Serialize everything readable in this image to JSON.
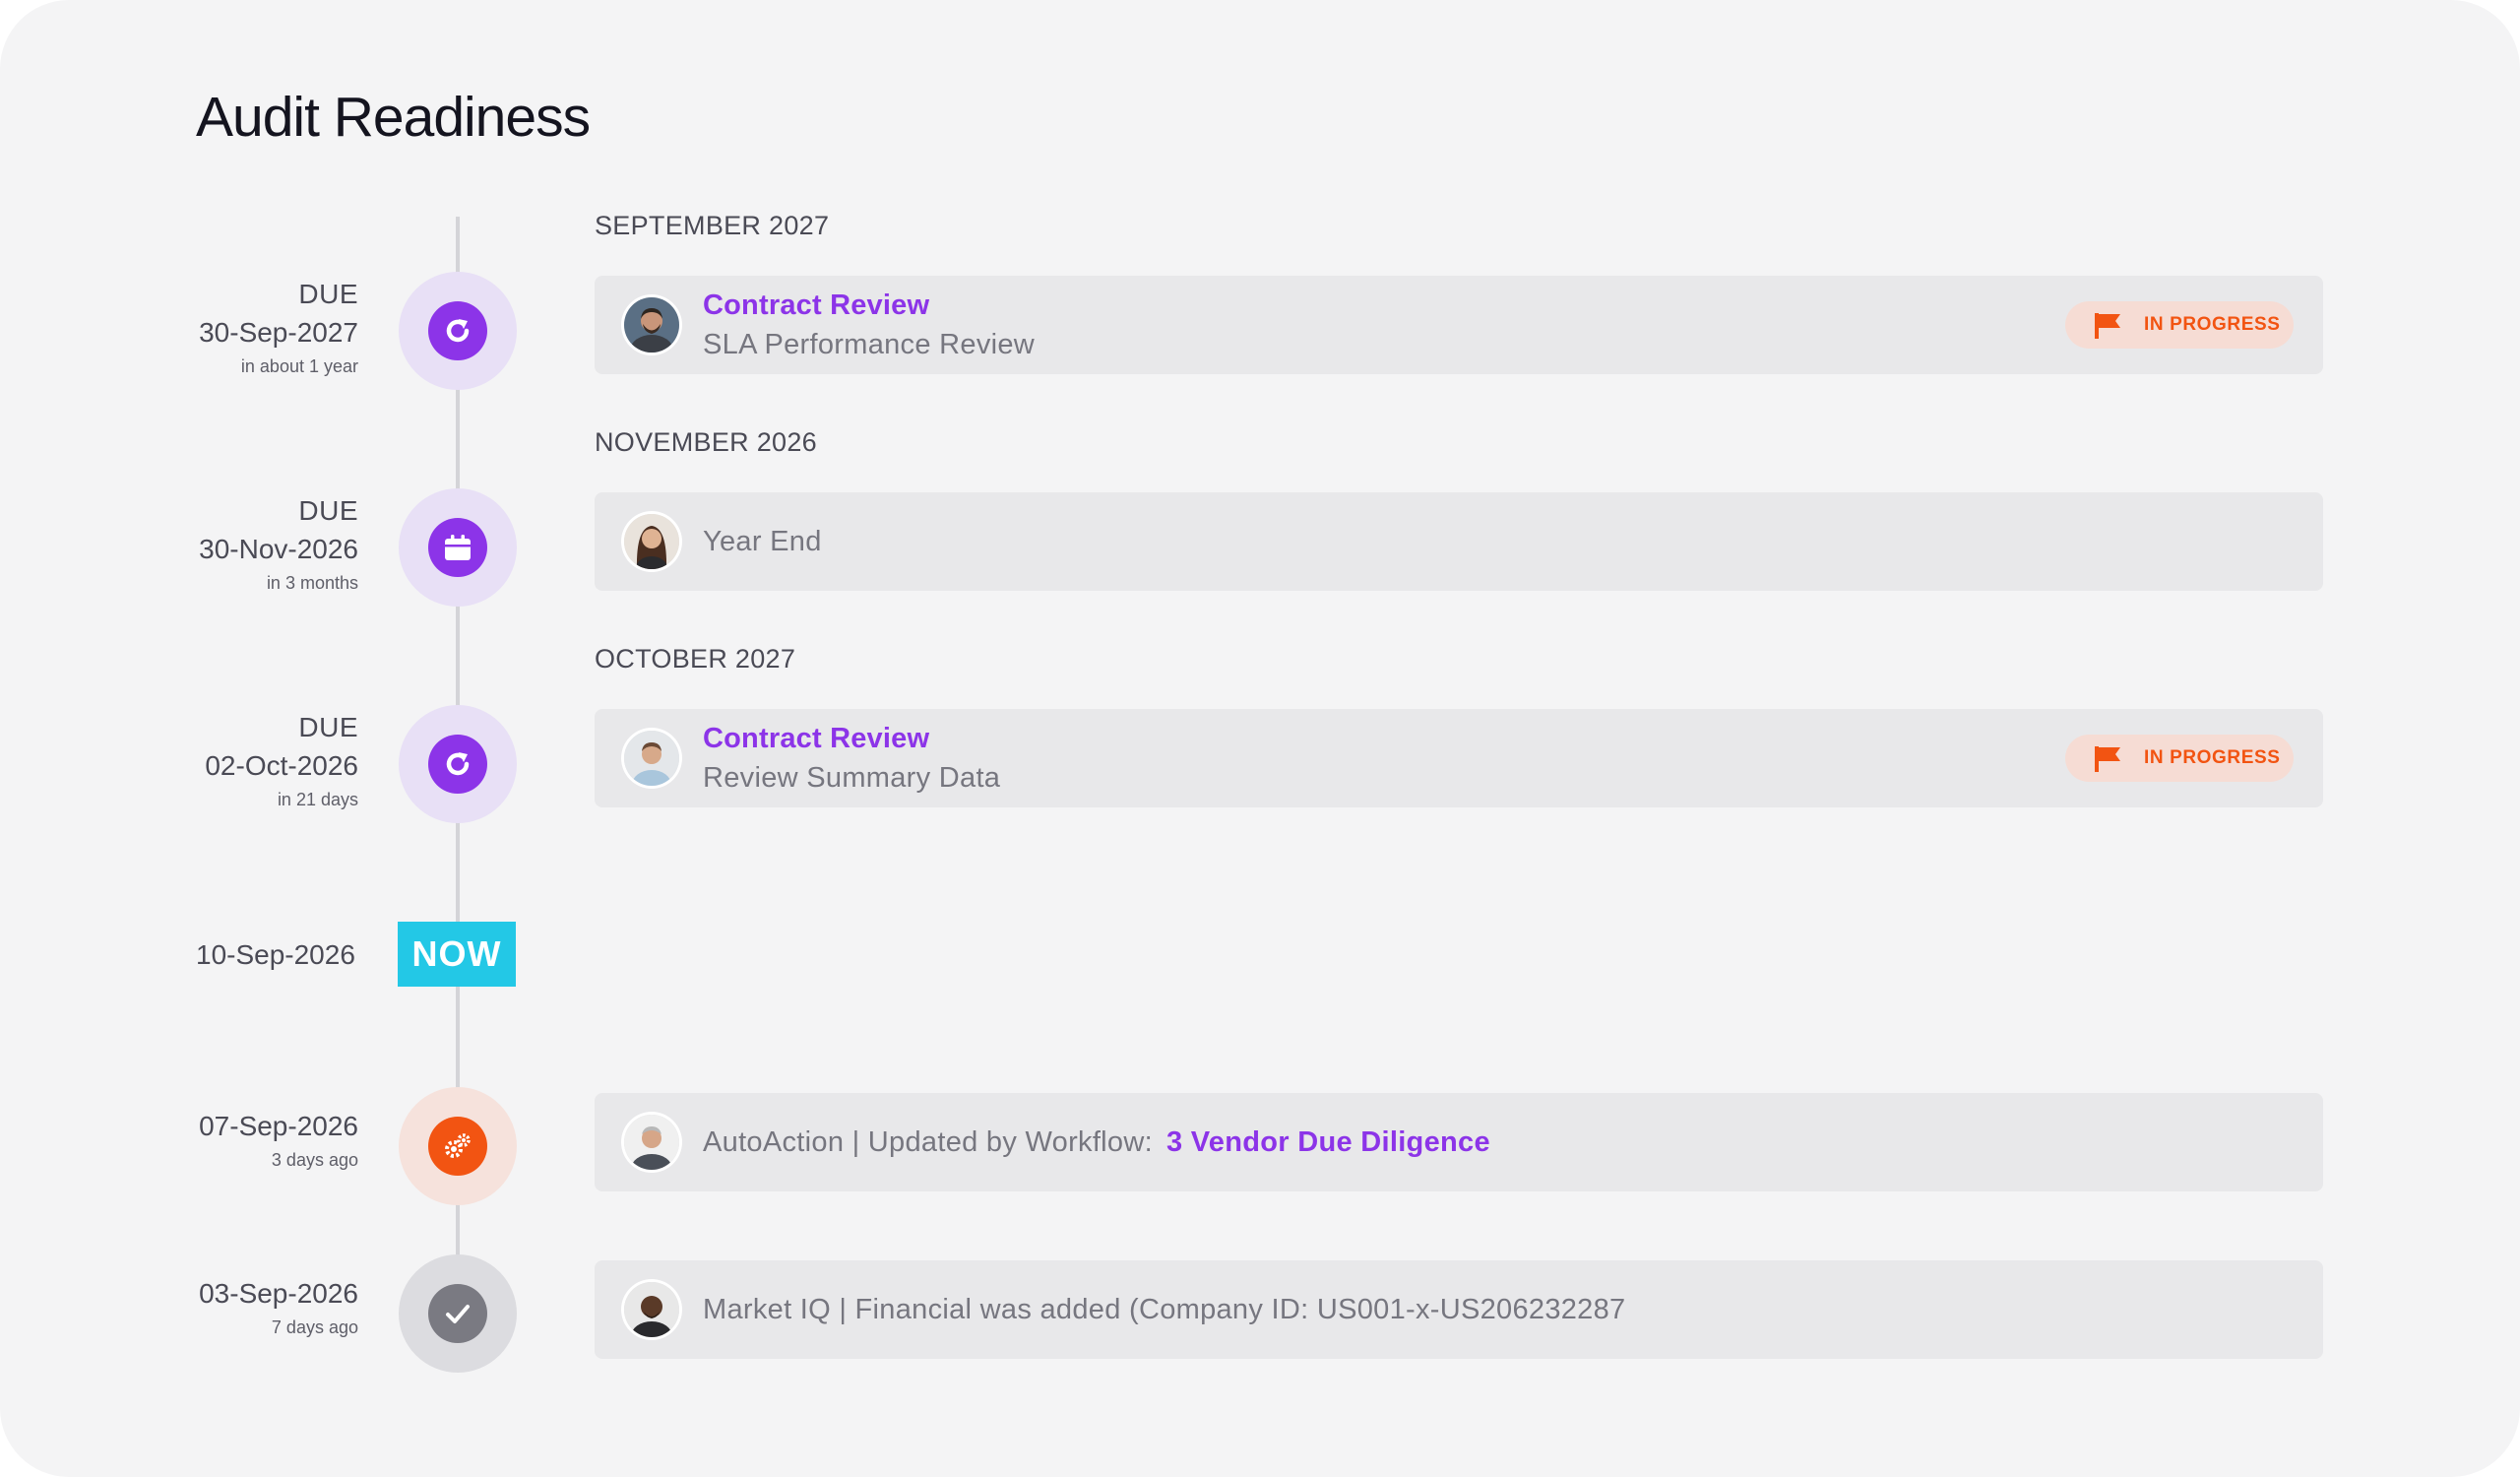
{
  "page": {
    "title": "Audit Readiness"
  },
  "colors": {
    "accent": "#8c34e8",
    "status_in_progress": "#f25412",
    "now_badge": "#23c8e6",
    "panel_background": "#f4f4f5"
  },
  "now": {
    "date": "10-Sep-2026",
    "label": "NOW"
  },
  "events": [
    {
      "month": "SEPTEMBER 2027",
      "due_label": "DUE",
      "date": "30-Sep-2027",
      "relative": "in about 1 year",
      "icon": "refresh-icon",
      "title": "Contract Review",
      "subtitle": "SLA Performance Review",
      "status": "IN PROGRESS"
    },
    {
      "month": "NOVEMBER 2026",
      "due_label": "DUE",
      "date": "30-Nov-2026",
      "relative": "in 3 months",
      "icon": "calendar-icon",
      "subtitle": "Year End"
    },
    {
      "month": "OCTOBER 2027",
      "due_label": "DUE",
      "date": "02-Oct-2026",
      "relative": "in 21 days",
      "icon": "refresh-icon",
      "title": "Contract Review",
      "subtitle": "Review Summary Data",
      "status": "IN PROGRESS"
    },
    {
      "date": "07-Sep-2026",
      "relative": "3 days ago",
      "icon": "gears-icon",
      "text": "AutoAction | Updated by Workflow:",
      "link": "3 Vendor Due Diligence"
    },
    {
      "date": "03-Sep-2026",
      "relative": "7 days ago",
      "icon": "checkmark-icon",
      "text": "Market IQ | Financial was added (Company ID: US001-x-US206232287"
    }
  ]
}
